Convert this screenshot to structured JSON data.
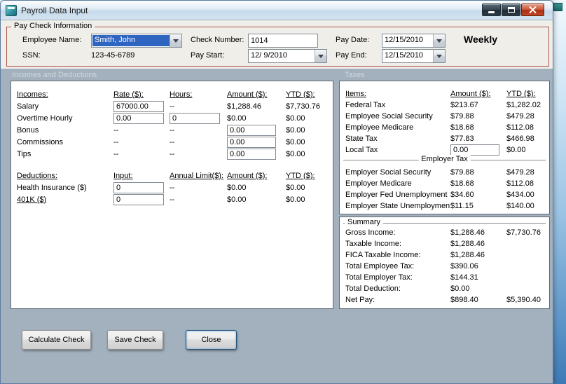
{
  "window": {
    "title": "Payroll Data Input"
  },
  "pay_check_info": {
    "group_title": "Pay Check Information",
    "fields": {
      "employee_name": {
        "label": "Employee Name:",
        "value": "Smith, John"
      },
      "ssn": {
        "label": "SSN:",
        "value": "123-45-6789"
      },
      "check_number": {
        "label": "Check Number:",
        "value": "1014"
      },
      "pay_start": {
        "label": "Pay Start:",
        "value": "12/ 9/2010"
      },
      "pay_date": {
        "label": "Pay Date:",
        "value": "12/15/2010"
      },
      "pay_end": {
        "label": "Pay End:",
        "value": "12/15/2010"
      },
      "frequency": "Weekly"
    }
  },
  "section_labels": {
    "incomes_and_deductions": "Incomes and Deductions",
    "taxes": "Taxes"
  },
  "incomes": {
    "headers": {
      "name": "Incomes:",
      "rate": "Rate ($):",
      "hours": "Hours:",
      "amount": "Amount ($):",
      "ytd": "YTD ($):"
    },
    "rows": {
      "salary": {
        "label": "Salary",
        "rate": "67000.00",
        "hours": "--",
        "amount": "$1,288.46",
        "ytd": "$7,730.76"
      },
      "overtime": {
        "label": "Overtime Hourly",
        "rate": "0.00",
        "hours": "0",
        "amount": "$0.00",
        "ytd": "$0.00"
      },
      "bonus": {
        "label": "Bonus",
        "rate": "--",
        "hours": "--",
        "amount": "0.00",
        "ytd": "$0.00"
      },
      "commissions": {
        "label": "Commissions",
        "rate": "--",
        "hours": "--",
        "amount": "0.00",
        "ytd": "$0.00"
      },
      "tips": {
        "label": "Tips",
        "rate": "--",
        "hours": "--",
        "amount": "0.00",
        "ytd": "$0.00"
      }
    }
  },
  "deductions": {
    "headers": {
      "name": "Deductions:",
      "input": "Input:",
      "limit": "Annual Limit($):",
      "amount": "Amount ($):",
      "ytd": "YTD ($):"
    },
    "rows": {
      "health": {
        "label": "Health Insurance ($)",
        "input": "0",
        "limit": "--",
        "amount": "$0.00",
        "ytd": "$0.00"
      },
      "k401": {
        "label": "401K ($)",
        "input": "0",
        "limit": "--",
        "amount": "$0.00",
        "ytd": "$0.00"
      }
    }
  },
  "taxes": {
    "headers": {
      "items": "Items:",
      "amount": "Amount ($):",
      "ytd": "YTD ($):"
    },
    "employee_rows": [
      {
        "label": "Federal Tax",
        "amount": "$213.67",
        "ytd": "$1,282.02"
      },
      {
        "label": "Employee Social Security",
        "amount": "$79.88",
        "ytd": "$479.28"
      },
      {
        "label": "Employee Medicare",
        "amount": "$18.68",
        "ytd": "$112.08"
      },
      {
        "label": "State Tax",
        "amount": "$77.83",
        "ytd": "$466.98"
      },
      {
        "label": "Local Tax",
        "amount": "0.00",
        "ytd": "$0.00"
      }
    ],
    "employer_group_title": "Employer Tax",
    "employer_rows": [
      {
        "label": "Employer Social Security",
        "amount": "$79.88",
        "ytd": "$479.28"
      },
      {
        "label": "Employer Medicare",
        "amount": "$18.68",
        "ytd": "$112.08"
      },
      {
        "label": "Employer Fed Unemployment",
        "amount": "$34.60",
        "ytd": "$434.00"
      },
      {
        "label": "Employer State Unemployment",
        "amount": "$11.15",
        "ytd": "$140.00"
      }
    ]
  },
  "summary": {
    "title": "Summary",
    "rows": [
      {
        "label": "Gross Income:",
        "amount": "$1,288.46",
        "ytd": "$7,730.76"
      },
      {
        "label": "Taxable Income:",
        "amount": "$1,288.46",
        "ytd": ""
      },
      {
        "label": "FICA Taxable Income:",
        "amount": "$1,288.46",
        "ytd": ""
      },
      {
        "label": "Total Employee Tax:",
        "amount": "$390.06",
        "ytd": ""
      },
      {
        "label": "Total Employer Tax:",
        "amount": "$144.31",
        "ytd": ""
      },
      {
        "label": "Total Deduction:",
        "amount": "$0.00",
        "ytd": ""
      },
      {
        "label": "Net Pay:",
        "amount": "$898.40",
        "ytd": "$5,390.40"
      }
    ]
  },
  "buttons": {
    "calculate": "Calculate Check",
    "save": "Save Check",
    "close": "Close"
  },
  "colors": {
    "group_border": "#ac544b",
    "section_background": "#a3b1be",
    "selection_highlight": "#2e65c0",
    "close_button_red": "#c04726",
    "titlebar_blue": "#c8dbeb"
  }
}
